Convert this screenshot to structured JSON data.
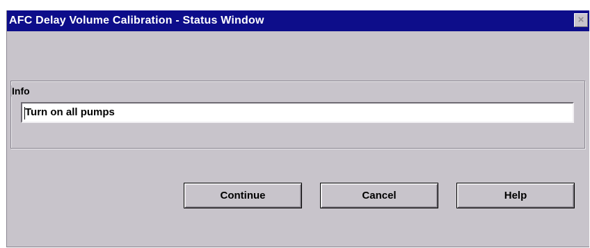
{
  "window": {
    "title": "AFC Delay Volume Calibration - Status Window",
    "close_glyph": "×"
  },
  "info": {
    "group_label": "Info",
    "message": "Turn on all pumps"
  },
  "buttons": {
    "continue": "Continue",
    "cancel": "Cancel",
    "help": "Help"
  },
  "colors": {
    "titlebar": "#0d0d8a",
    "window_bg": "#c8c4cb",
    "field_bg": "#ffffff"
  },
  "icons": {
    "close": "close-icon"
  }
}
